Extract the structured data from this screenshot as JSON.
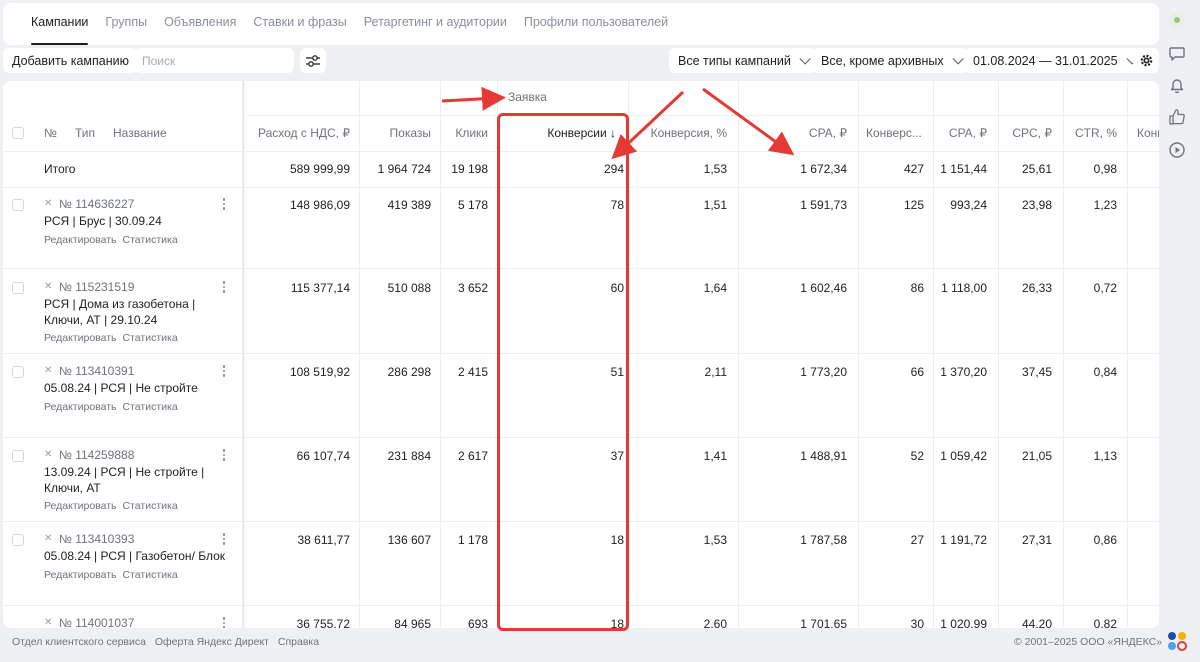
{
  "tabs": [
    "Кампании",
    "Группы",
    "Объявления",
    "Ставки и фразы",
    "Ретаргетинг и аудитории",
    "Профили пользователей"
  ],
  "toolbar": {
    "add_campaign": "Добавить кампанию",
    "search_placeholder": "Поиск",
    "campaign_types": "Все типы кампаний",
    "status_filter": "Все, кроме архивных",
    "date_range": "01.08.2024 — 31.01.2025"
  },
  "group_header": "Заявка",
  "columns": {
    "num": "№",
    "type": "Тип",
    "name": "Название",
    "spend": "Расход с НДС, ₽",
    "impressions": "Показы",
    "clicks": "Клики",
    "conversions": "Конверсии ↓",
    "conv_rate": "Конверсия, %",
    "cpa": "CPA, ₽",
    "conversions2": "Конверс...",
    "cpa2": "CPA, ₽",
    "cpc": "CPC, ₽",
    "ctr": "CTR, %",
    "more": "Конв"
  },
  "total": {
    "label": "Итого",
    "spend": "589 999,99",
    "impressions": "1 964 724",
    "clicks": "19 198",
    "conversions": "294",
    "conv_rate": "1,53",
    "cpa": "1 672,34",
    "conversions2": "427",
    "cpa2": "1 151,44",
    "cpc": "25,61",
    "ctr": "0,98"
  },
  "row_links": {
    "edit": "Редактировать",
    "stats": "Статистика"
  },
  "rows": [
    {
      "id": "№ 114636227",
      "name": "РСЯ | Брус | 30.09.24",
      "spend": "148 986,09",
      "impressions": "419 389",
      "clicks": "5 178",
      "conversions": "78",
      "conv_rate": "1,51",
      "cpa": "1 591,73",
      "conversions2": "125",
      "cpa2": "993,24",
      "cpc": "23,98",
      "ctr": "1,23"
    },
    {
      "id": "№ 115231519",
      "name": "РСЯ | Дома из газобетона | Ключи, АТ | 29.10.24",
      "spend": "115 377,14",
      "impressions": "510 088",
      "clicks": "3 652",
      "conversions": "60",
      "conv_rate": "1,64",
      "cpa": "1 602,46",
      "conversions2": "86",
      "cpa2": "1 118,00",
      "cpc": "26,33",
      "ctr": "0,72"
    },
    {
      "id": "№ 113410391",
      "name": "05.08.24 | РСЯ | Не стройте",
      "spend": "108 519,92",
      "impressions": "286 298",
      "clicks": "2 415",
      "conversions": "51",
      "conv_rate": "2,11",
      "cpa": "1 773,20",
      "conversions2": "66",
      "cpa2": "1 370,20",
      "cpc": "37,45",
      "ctr": "0,84"
    },
    {
      "id": "№ 114259888",
      "name": "13.09.24 | РСЯ | Не стройте | Ключи, АТ",
      "spend": "66 107,74",
      "impressions": "231 884",
      "clicks": "2 617",
      "conversions": "37",
      "conv_rate": "1,41",
      "cpa": "1 488,91",
      "conversions2": "52",
      "cpa2": "1 059,42",
      "cpc": "21,05",
      "ctr": "1,13"
    },
    {
      "id": "№ 113410393",
      "name": "05.08.24 | РСЯ | Газобетон/ Блок",
      "spend": "38 611,77",
      "impressions": "136 607",
      "clicks": "1 178",
      "conversions": "18",
      "conv_rate": "1,53",
      "cpa": "1 787,58",
      "conversions2": "27",
      "cpa2": "1 191,72",
      "cpc": "27,31",
      "ctr": "0,86"
    },
    {
      "id": "№ 114001037",
      "name": "",
      "spend": "36 755,72",
      "impressions": "84 965",
      "clicks": "693",
      "conversions": "18",
      "conv_rate": "2,60",
      "cpa": "1 701,65",
      "conversions2": "30",
      "cpa2": "1 020,99",
      "cpc": "44,20",
      "ctr": "0,82"
    }
  ],
  "footer": {
    "support": "Отдел клиентского сервиса",
    "offer": "Оферта Яндекс Директ",
    "help": "Справка",
    "copyright": "© 2001–2025 ООО «ЯНДЕКС»"
  },
  "colors": {
    "highlight": "#e53935",
    "panel": "#ffffff",
    "background": "#eef0f4"
  }
}
